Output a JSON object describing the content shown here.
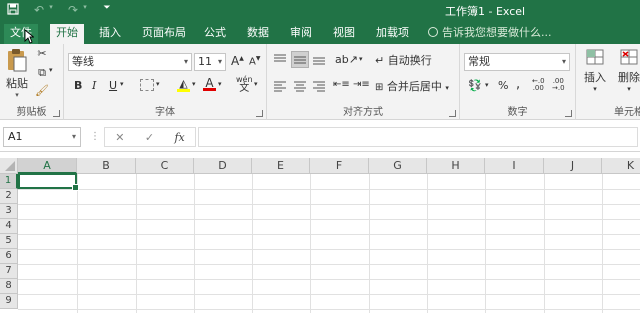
{
  "titlebar": {
    "title": "工作簿1 - Excel",
    "save_icon": "save-icon",
    "undo_icon": "undo-icon",
    "redo_icon": "redo-icon",
    "customize_icon": "customize-qat-icon"
  },
  "tabs": [
    "文件",
    "开始",
    "插入",
    "页面布局",
    "公式",
    "数据",
    "审阅",
    "视图",
    "加载项"
  ],
  "active_tab": "开始",
  "tell_me": "告诉我您想要做什么...",
  "ribbon": {
    "clipboard": {
      "paste_label": "粘贴",
      "group_label": "剪贴板"
    },
    "font": {
      "font_name": "等线",
      "font_size": "11",
      "bold": "B",
      "italic": "I",
      "underline": "U",
      "grow": "A",
      "shrink": "A",
      "phonetic": "wén",
      "group_label": "字体"
    },
    "alignment": {
      "wrap_text": "自动换行",
      "merge_center": "合并后居中",
      "group_label": "对齐方式"
    },
    "number": {
      "format": "常规",
      "percent": "%",
      "comma": ",",
      "group_label": "数字"
    },
    "cells": {
      "insert": "插入",
      "delete": "删除",
      "group_label": "单元格"
    }
  },
  "formula_bar": {
    "name_box": "A1",
    "cancel": "✕",
    "enter": "✓",
    "fx": "fx",
    "value": ""
  },
  "columns": [
    "A",
    "B",
    "C",
    "D",
    "E",
    "F",
    "G",
    "H",
    "I",
    "J",
    "K"
  ],
  "rows": [
    "1",
    "2",
    "3",
    "4",
    "5",
    "6",
    "7",
    "8",
    "9"
  ],
  "active_cell": "A1",
  "colors": {
    "accent": "#217346",
    "ribbon_bg": "#f3f3f3"
  }
}
